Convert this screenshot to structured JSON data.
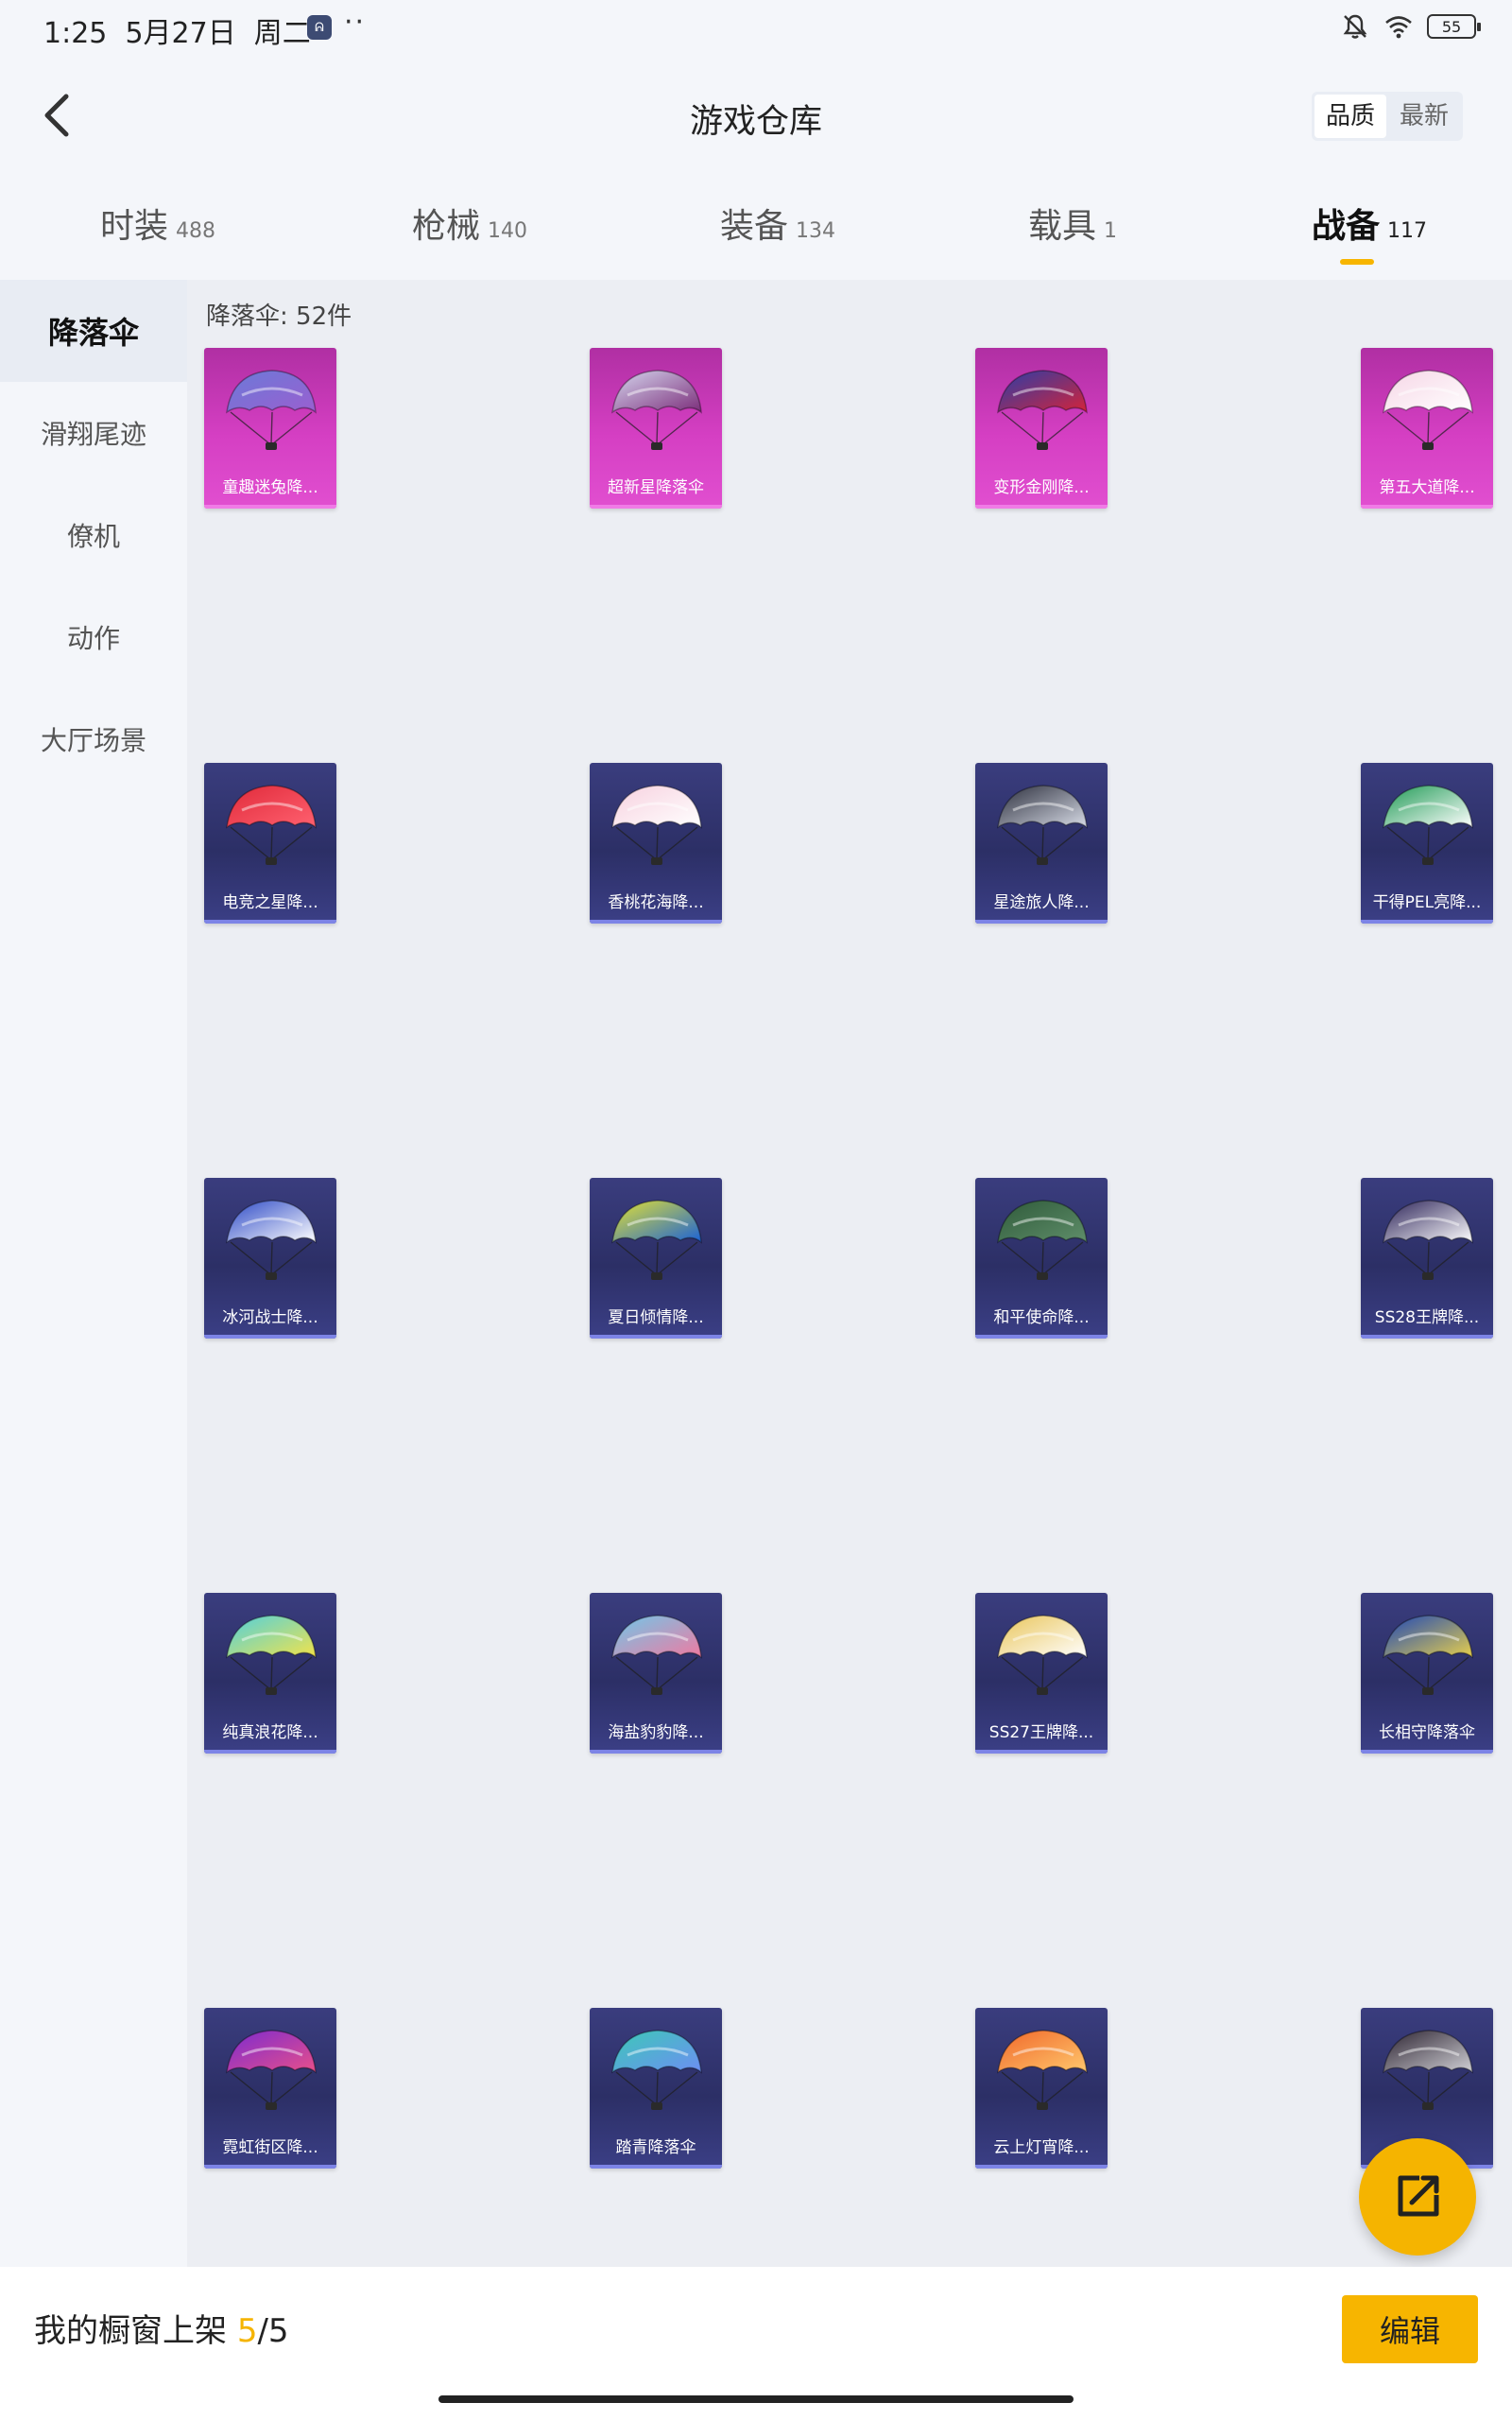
{
  "status": {
    "time": "1:25",
    "date": "5月27日",
    "weekday": "周二",
    "app_icon_text": "ᕱ",
    "dots": "··",
    "battery": "55"
  },
  "header": {
    "title": "游戏仓库",
    "sort_options": [
      "品质",
      "最新"
    ],
    "sort_selected": "品质"
  },
  "tabs": [
    {
      "label": "时装",
      "count": "488"
    },
    {
      "label": "枪械",
      "count": "140"
    },
    {
      "label": "装备",
      "count": "134"
    },
    {
      "label": "载具",
      "count": "1"
    },
    {
      "label": "战备",
      "count": "117",
      "active": true
    }
  ],
  "sidebar": {
    "items": [
      {
        "label": "降落伞",
        "active": true
      },
      {
        "label": "滑翔尾迹"
      },
      {
        "label": "僚机"
      },
      {
        "label": "动作"
      },
      {
        "label": "大厅场景"
      }
    ]
  },
  "main": {
    "count_label": "降落伞: 52件",
    "items": [
      {
        "name": "童趣迷兔降...",
        "tier": "pink",
        "colors": [
          "#6b7ad8",
          "#9a5fd0"
        ],
        "icon": "parachute-icon"
      },
      {
        "name": "超新星降落伞",
        "tier": "pink",
        "colors": [
          "#d6d8ef",
          "#7b2d7a"
        ],
        "icon": "parachute-icon"
      },
      {
        "name": "变形金刚降...",
        "tier": "pink",
        "colors": [
          "#2b3ea8",
          "#d4233a"
        ],
        "icon": "parachute-icon"
      },
      {
        "name": "第五大道降...",
        "tier": "pink",
        "colors": [
          "#f6d6e6",
          "#ffffff"
        ],
        "icon": "parachute-icon"
      },
      {
        "name": "电竞之星降...",
        "tier": "blue",
        "colors": [
          "#e02a3a",
          "#ff6170"
        ],
        "icon": "parachute-icon"
      },
      {
        "name": "香桃花海降...",
        "tier": "blue",
        "colors": [
          "#f7d1df",
          "#ffffff"
        ],
        "icon": "parachute-icon"
      },
      {
        "name": "星途旅人降...",
        "tier": "blue",
        "colors": [
          "#2c2f3d",
          "#d7dbe6"
        ],
        "icon": "parachute-icon"
      },
      {
        "name": "干得PEL亮降...",
        "tier": "blue",
        "colors": [
          "#1f9a55",
          "#ffffff"
        ],
        "icon": "parachute-icon"
      },
      {
        "name": "冰河战士降...",
        "tier": "blue",
        "colors": [
          "#2c49c6",
          "#ffffff"
        ],
        "icon": "parachute-icon"
      },
      {
        "name": "夏日倾情降...",
        "tier": "blue",
        "colors": [
          "#e4e232",
          "#1b62d6"
        ],
        "icon": "parachute-icon"
      },
      {
        "name": "和平使命降...",
        "tier": "blue",
        "colors": [
          "#2f5a3a",
          "#5f8e6a"
        ],
        "icon": "parachute-icon"
      },
      {
        "name": "SS28王牌降...",
        "tier": "blue",
        "colors": [
          "#2a2157",
          "#ffffff"
        ],
        "icon": "parachute-icon"
      },
      {
        "name": "纯真浪花降...",
        "tier": "blue",
        "colors": [
          "#4fd0e0",
          "#f2e34a"
        ],
        "icon": "parachute-icon"
      },
      {
        "name": "海盐豹豹降...",
        "tier": "blue",
        "colors": [
          "#6fc8ea",
          "#ef7aa1"
        ],
        "icon": "parachute-icon"
      },
      {
        "name": "SS27王牌降...",
        "tier": "blue",
        "colors": [
          "#e9c55a",
          "#ffffff"
        ],
        "icon": "parachute-icon"
      },
      {
        "name": "长相守降落伞",
        "tier": "blue",
        "colors": [
          "#1c46b8",
          "#e7cf4c"
        ],
        "icon": "parachute-icon"
      },
      {
        "name": "霓虹街区降...",
        "tier": "blue",
        "colors": [
          "#7b2bd0",
          "#e84f8a"
        ],
        "icon": "parachute-icon"
      },
      {
        "name": "踏青降落伞",
        "tier": "blue",
        "colors": [
          "#3cc9b7",
          "#6d8ef3"
        ],
        "icon": "parachute-icon"
      },
      {
        "name": "云上灯宵降...",
        "tier": "blue",
        "colors": [
          "#f0672a",
          "#ffc86d"
        ],
        "icon": "parachute-icon"
      },
      {
        "name": "",
        "tier": "blue",
        "colors": [
          "#2b2230",
          "#d1d1d6"
        ],
        "icon": "parachute-icon"
      }
    ]
  },
  "fab": {
    "icon": "share-icon"
  },
  "bottom": {
    "label": "我的橱窗上架",
    "count": "5",
    "total": "/5",
    "edit_label": "编辑"
  },
  "colors": {
    "accent": "#f7b500",
    "pink_tier": "#d53fc3",
    "blue_tier": "#2c2f66"
  }
}
